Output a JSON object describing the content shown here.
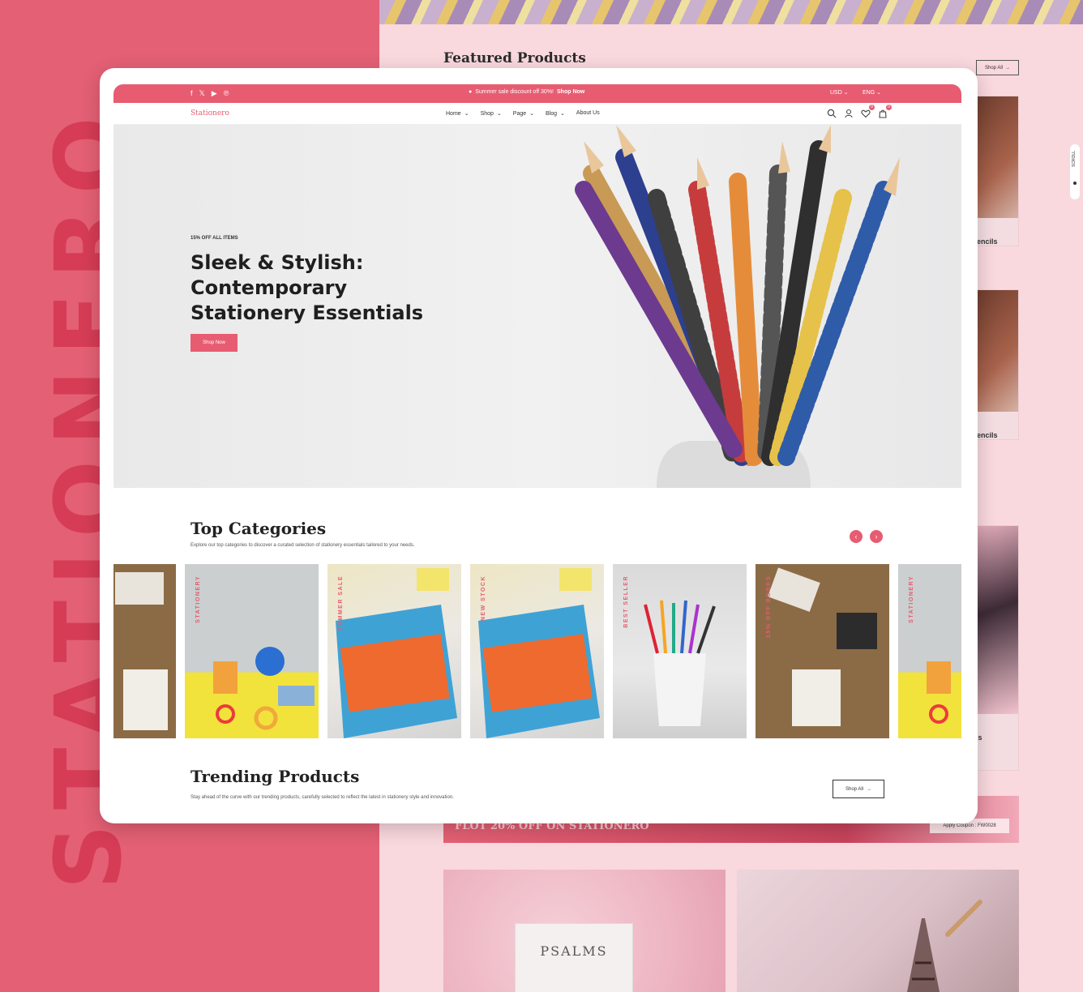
{
  "brand_vertical": "STATIONERO",
  "background_page": {
    "featured_title": "Featured Products",
    "shop_all": "Shop All",
    "product_names": [
      "g Pencils",
      "g Pencils",
      "ncils"
    ],
    "scroll_label": "SCROLL",
    "coupon_text": "FLOT 20% OFF ON STATIONERO",
    "coupon_button": "Apply Coupon : FW0028",
    "blog_book_title": "PSALMS"
  },
  "topbar": {
    "announcement": "Summer sale discount off 30%!",
    "announcement_link": "Shop Now",
    "currency": "USD",
    "language": "ENG"
  },
  "navbar": {
    "logo": "Stationero",
    "menu": [
      "Home",
      "Shop",
      "Page",
      "Blog",
      "About Us"
    ],
    "wishlist_count": "0",
    "cart_count": "0"
  },
  "hero": {
    "kicker": "15% OFF ALL ITEMS",
    "title": "Sleek & Stylish: Contemporary Stationery Essentials",
    "button": "Shop Now"
  },
  "categories": {
    "title": "Top Categories",
    "description": "Explore our top categories to discover a curated selection of stationery essentials tailored to your needs.",
    "tiles": [
      "",
      "STATIONERY",
      "SUMMER SALE",
      "NEW STOCK",
      "BEST SELLER",
      "15% OFF BOOKS",
      "STATIONERY"
    ]
  },
  "trending": {
    "title": "Trending Products",
    "description": "Stay ahead of the curve with our trending products, carefully selected to reflect the latest in stationery style and innovation.",
    "shop_all": "Shop All"
  },
  "colors": {
    "accent": "#e75c71",
    "left_panel": "#e46074",
    "right_panel": "#f9d8de"
  }
}
